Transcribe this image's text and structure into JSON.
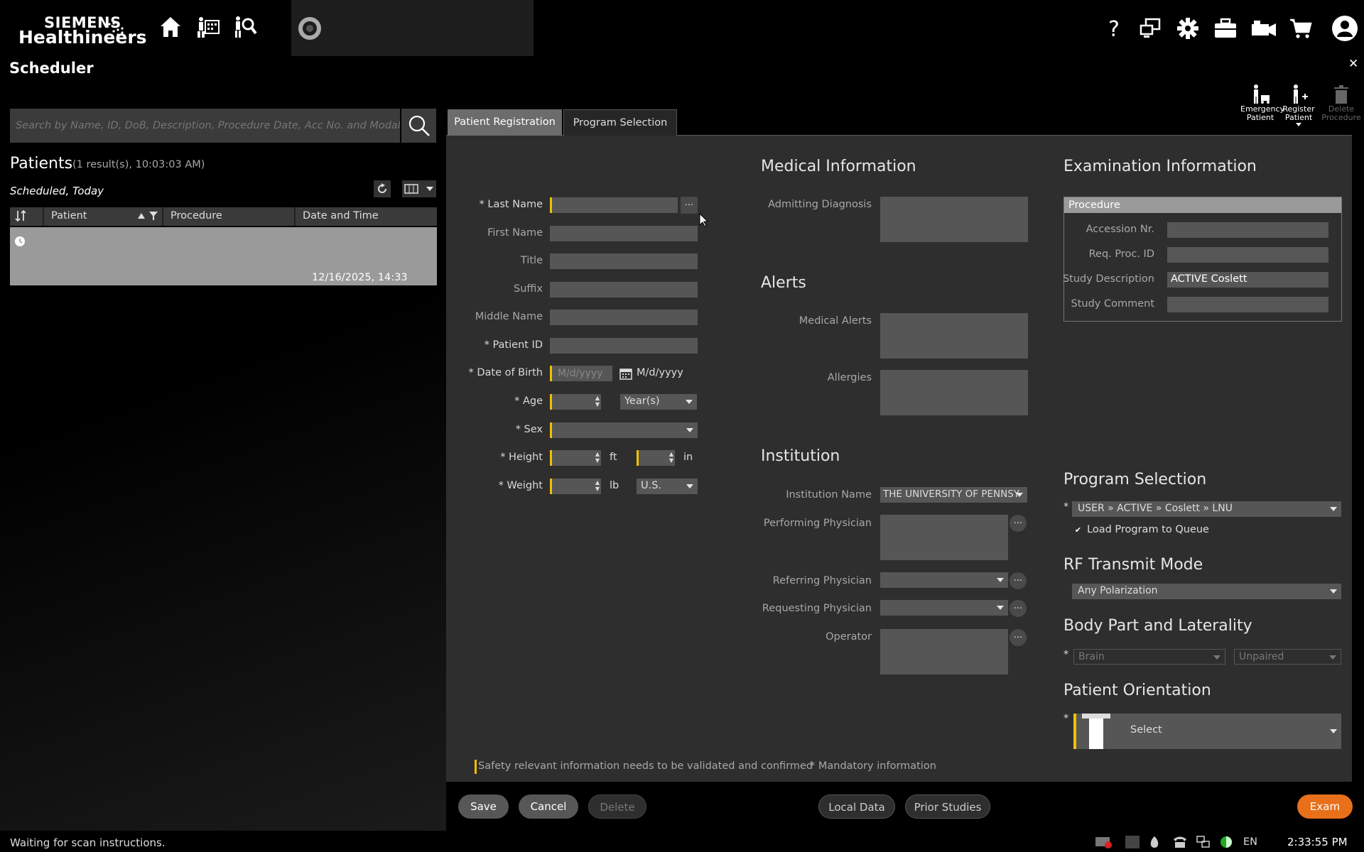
{
  "header": {
    "brand_line1": "SIEMENS",
    "brand_line2": "Healthineers",
    "icons": [
      "home-icon",
      "scheduler-icon",
      "patient-browser-icon",
      "exam-ring-icon",
      "help-icon",
      "display-icon",
      "gear-icon",
      "toolbox-icon",
      "camera-icon",
      "cart-icon",
      "user-icon"
    ]
  },
  "scheduler": {
    "title": "Scheduler",
    "close": "✕",
    "search_placeholder": "Search by Name, ID, DoB, Description, Procedure Date, Acc No. and Modality (Ctrl+F)",
    "patients_title": "Patients",
    "patients_count": "(1 result(s), 10:03:03 AM)",
    "filter_label": "Scheduled, Today",
    "columns": [
      "Patient",
      "Procedure",
      "Date and Time"
    ],
    "row_datetime": "12/16/2025, 14:33",
    "status": "Waiting for scan instructions."
  },
  "actions": {
    "emergency_1": "Emergency",
    "emergency_2": "Patient",
    "register_1": "Register",
    "register_2": "Patient",
    "delete_1": "Delete",
    "delete_2": "Procedure"
  },
  "tabs": {
    "active": "Patient Registration",
    "other": "Program Selection"
  },
  "patient": {
    "last_name": "* Last Name",
    "first_name": "First Name",
    "title": "Title",
    "suffix": "Suffix",
    "middle_name": "Middle Name",
    "patient_id": "* Patient ID",
    "dob": "* Date of Birth",
    "dob_placeholder": "M/d/yyyy",
    "dob_format": "M/d/yyyy",
    "age": "* Age",
    "age_unit": "Year(s)",
    "sex": "* Sex",
    "height": "* Height",
    "height_ft": "ft",
    "height_in": "in",
    "weight": "* Weight",
    "weight_unit": "lb",
    "weight_system": "U.S.",
    "dots": "..."
  },
  "medical": {
    "title": "Medical Information",
    "admitting": "Admitting Diagnosis",
    "alerts_title": "Alerts",
    "medical_alerts": "Medical Alerts",
    "allergies": "Allergies"
  },
  "institution": {
    "title": "Institution",
    "name_label": "Institution Name",
    "name_value": "THE UNIVERSITY OF PENNSY",
    "performing": "Performing Physician",
    "referring": "Referring Physician",
    "requesting": "Requesting Physician",
    "operator": "Operator"
  },
  "exam": {
    "title": "Examination Information",
    "procedure": "Procedure",
    "accession": "Accession Nr.",
    "req_proc": "Req. Proc. ID",
    "study_desc": "Study Description",
    "study_desc_value": "ACTIVE Coslett",
    "study_comment": "Study Comment"
  },
  "program": {
    "title": "Program Selection",
    "path": "USER » ACTIVE » Coslett » LNU",
    "load_queue": "Load Program to Queue",
    "rf_title": "RF Transmit Mode",
    "rf_value": "Any Polarization",
    "body_title": "Body Part and Laterality",
    "body_part": "Brain",
    "laterality": "Unpaired",
    "orient_title": "Patient Orientation",
    "orient_value": "Select",
    "star": "*"
  },
  "footer": {
    "safety_note": "Safety relevant information needs to be validated and confirmed",
    "mandatory_note": "* Mandatory information",
    "save": "Save",
    "cancel": "Cancel",
    "delete": "Delete",
    "local_data": "Local Data",
    "prior_studies": "Prior Studies",
    "exam": "Exam"
  },
  "taskbar": {
    "lang": "EN",
    "time": "2:33:55 PM"
  },
  "colors": {
    "accent_orange": "#e8701a",
    "required_yellow": "#f0c000",
    "panel": "#2e2e2e",
    "field": "#565656"
  }
}
